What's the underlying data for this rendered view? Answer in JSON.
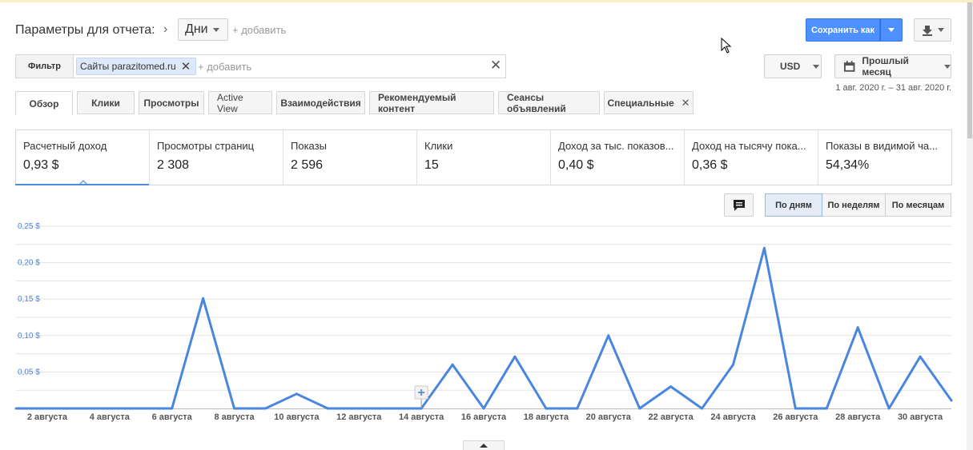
{
  "header": {
    "params_title": "Параметры для отчета:",
    "dimension": "Дни",
    "add_dimension": "+ добавить",
    "save_label": "Сохранить как"
  },
  "filter": {
    "label": "Фильтр",
    "chip_prefix": "Сайты",
    "chip_value": "parazitomed.ru",
    "add_label": "+ добавить"
  },
  "currency": "USD",
  "period": {
    "label": "Прошлый месяц",
    "range": "1 авг. 2020 г. – 31 авг. 2020 г."
  },
  "tabs": [
    {
      "label": "Обзор"
    },
    {
      "label": "Клики"
    },
    {
      "label": "Просмотры"
    },
    {
      "label": "Active View"
    },
    {
      "label": "Взаимодействия"
    },
    {
      "label": "Рекомендуемый контент"
    },
    {
      "label": "Сеансы объявлений"
    },
    {
      "label": "Специальные"
    }
  ],
  "metrics": [
    {
      "label": "Расчетный доход",
      "value": "0,93 $"
    },
    {
      "label": "Просмотры страниц",
      "value": "2 308"
    },
    {
      "label": "Показы",
      "value": "2 596"
    },
    {
      "label": "Клики",
      "value": "15"
    },
    {
      "label": "Доход за тыс. показов...",
      "value": "0,40 $"
    },
    {
      "label": "Доход на тысячу пока...",
      "value": "0,36 $"
    },
    {
      "label": "Показы в видимой ча...",
      "value": "54,34%"
    }
  ],
  "granularity": {
    "day": "По дням",
    "week": "По неделям",
    "month": "По месяцам"
  },
  "colors": {
    "accent": "#4d90fe",
    "series": "#4a86e0",
    "axis_label": "#4a7fd4"
  },
  "chart_data": {
    "type": "line",
    "x": [
      "1 августа",
      "2 августа",
      "3 августа",
      "4 августа",
      "5 августа",
      "6 августа",
      "7 августа",
      "8 августа",
      "9 августа",
      "10 августа",
      "11 августа",
      "12 августа",
      "13 августа",
      "14 августа",
      "15 августа",
      "16 августа",
      "17 августа",
      "18 августа",
      "19 августа",
      "20 августа",
      "21 августа",
      "22 августа",
      "23 августа",
      "24 августа",
      "25 августа",
      "26 августа",
      "27 августа",
      "28 августа",
      "29 августа",
      "30 августа",
      "31 августа"
    ],
    "x_tick_labels": [
      "2 августа",
      "4 августа",
      "6 августа",
      "8 августа",
      "10 августа",
      "12 августа",
      "14 августа",
      "16 августа",
      "18 августа",
      "20 августа",
      "22 августа",
      "24 августа",
      "26 августа",
      "28 августа",
      "30 августа"
    ],
    "series": [
      {
        "values": [
          0,
          0,
          0,
          0,
          0,
          0,
          0.151,
          0,
          0,
          0.02,
          0,
          0,
          0,
          0,
          0.06,
          0,
          0.071,
          0,
          0,
          0.1,
          0,
          0.03,
          0,
          0.06,
          0.22,
          0,
          0,
          0.111,
          0,
          0.071,
          0.011
        ]
      }
    ],
    "y_ticks": [
      "0,05 $",
      "0,10 $",
      "0,15 $",
      "0,20 $",
      "0,25 $"
    ],
    "ylim": [
      0,
      0.25
    ],
    "grid": true
  }
}
